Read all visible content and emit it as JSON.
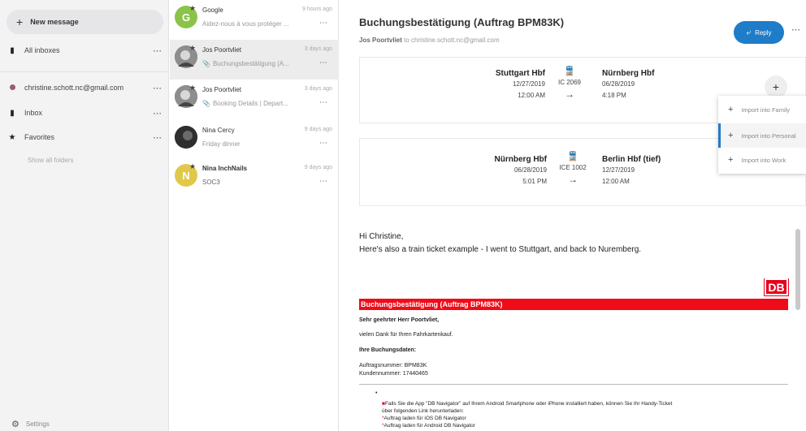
{
  "sidebar": {
    "new_message": "New message",
    "items": [
      {
        "label": "All inboxes",
        "icon": "inbox-icon"
      },
      {
        "label": "christine.schott.nc@gmail.com",
        "icon": "account-dot-icon"
      },
      {
        "label": "Inbox",
        "icon": "inbox-icon"
      },
      {
        "label": "Favorites",
        "icon": "star-icon"
      }
    ],
    "show_all": "Show all folders",
    "settings": "Settings"
  },
  "messages": [
    {
      "sender": "Google",
      "time": "9 hours ago",
      "subject": "Aidez-nous à vous protéger ...",
      "avatar": "G",
      "avatar_color": "#8bc34a",
      "attachment": false,
      "bold": false
    },
    {
      "sender": "Jos Poortvliet",
      "time": "3 days ago",
      "subject": "Buchungsbestätigung (A...",
      "avatar": "",
      "avatar_color": "#7a7a7a",
      "attachment": true,
      "bold": false
    },
    {
      "sender": "Jos Poortvliet",
      "time": "3 days ago",
      "subject": "Booking Details | Depart...",
      "avatar": "",
      "avatar_color": "#6e6e6e",
      "attachment": true,
      "bold": false
    },
    {
      "sender": "Nina Cercy",
      "time": "9 days ago",
      "subject": "Friday dinner",
      "avatar": "",
      "avatar_color": "#3a3a3a",
      "attachment": false,
      "bold": false
    },
    {
      "sender": "Nina InchNails",
      "time": "9 days ago",
      "subject": "SOC3",
      "avatar": "N",
      "avatar_color": "#e0c94a",
      "attachment": false,
      "bold": true
    }
  ],
  "reader": {
    "title": "Buchungsbestätigung (Auftrag BPM83K)",
    "from_name": "Jos Poortvliet",
    "from_to": "to",
    "to_email": "christine.schott.nc@gmail.com",
    "reply_label": "Reply",
    "legs": [
      {
        "from_station": "Stuttgart Hbf",
        "from_date": "12/27/2019",
        "from_time": "12:00 AM",
        "train": "IC 2069",
        "to_station": "Nürnberg Hbf",
        "to_date": "06/28/2019",
        "to_time": "4:18 PM"
      },
      {
        "from_station": "Nürnberg Hbf",
        "from_date": "06/28/2019",
        "from_time": "5:01 PM",
        "train": "ICE 1002",
        "to_station": "Berlin Hbf (tief)",
        "to_date": "12/27/2019",
        "to_time": "12:00 AM"
      }
    ],
    "import_menu": [
      {
        "label": "Import into Family"
      },
      {
        "label": "Import into Personal"
      },
      {
        "label": "Import into Work"
      }
    ],
    "greeting": "Hi Christine,",
    "body": "Here's also a train ticket example - I went to Stuttgart, and back to Nuremberg.",
    "mail": {
      "db_logo": "DB",
      "bar_title": "Buchungsbestätigung (Auftrag BPM83K)",
      "salutation": "Sehr geehrter Herr Poortvliet,",
      "thanks": "vielen Dank für Ihren Fahrkartenkauf.",
      "booking_heading": "Ihre Buchungsdaten:",
      "order_no": "Auftragsnummer: BPM83K",
      "customer_no": "Kundennummer: 17440465",
      "app_note": "Falls Sie die App \"DB Navigator\" auf Ihrem Android Smartphone oder iPhone installiert haben, können Sie Ihr Handy-Ticket",
      "app_note2": "über folgenden Link herunterladen:",
      "ios_link": "Auftrag laden für iOS DB Navigator",
      "android_link": "Auftrag laden für Android DB Navigator"
    }
  }
}
